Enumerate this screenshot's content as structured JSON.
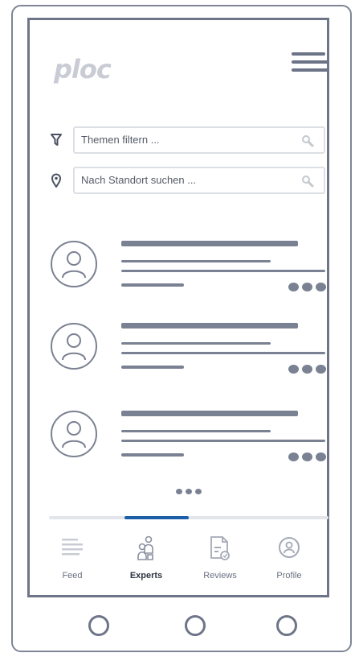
{
  "app": {
    "logo_text": "ploc"
  },
  "filters": {
    "topic_placeholder": "Themen filtern ...",
    "location_placeholder": "Nach Standort suchen ..."
  },
  "list": {
    "item_count": 3
  },
  "tabs": [
    {
      "label": "Feed",
      "icon": "feed-icon"
    },
    {
      "label": "Experts",
      "icon": "experts-icon",
      "active": true
    },
    {
      "label": "Reviews",
      "icon": "reviews-icon"
    },
    {
      "label": "Profile",
      "icon": "profile-icon"
    }
  ],
  "scroll_progress": {
    "start": 0.27,
    "end": 0.5
  },
  "colors": {
    "accent": "#1a5fa8",
    "wireframe": "#7a8192"
  }
}
